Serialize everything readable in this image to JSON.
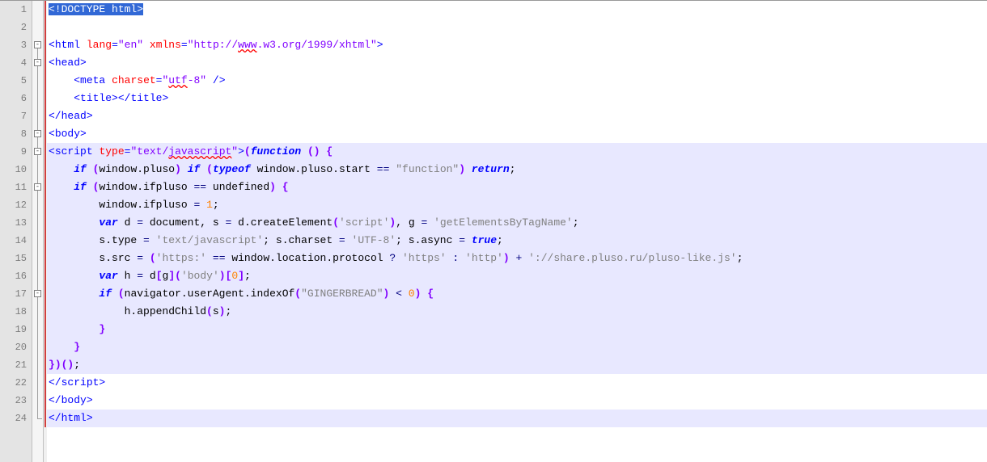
{
  "lineCount": 24,
  "selectedLine": 1,
  "highlightStart": 9,
  "highlightEnd": 21,
  "currentLine": 24,
  "foldIcons": [
    {
      "line": 3,
      "glyph": "-"
    },
    {
      "line": 4,
      "glyph": "-"
    },
    {
      "line": 8,
      "glyph": "-"
    },
    {
      "line": 9,
      "glyph": "-"
    },
    {
      "line": 11,
      "glyph": "-"
    },
    {
      "line": 17,
      "glyph": "-"
    }
  ],
  "foldVline": {
    "startLine": 3,
    "endLine": 24
  },
  "marginLine": {
    "startLine": 1,
    "endLine": 24
  },
  "code": {
    "l1_sel": "<!DOCTYPE html>",
    "l3": {
      "open": "<",
      "tag": "html",
      "sp": " ",
      "a1": "lang",
      "eq": "=",
      "v1": "\"en\"",
      "sp2": " ",
      "a2": "xmlns",
      "eq2": "=",
      "v2": "\"http://",
      "wavy": "www",
      "v2b": ".w3.org/1999/xhtml\"",
      "close": ">"
    },
    "l4": {
      "open": "<",
      "tag": "head",
      "close": ">"
    },
    "l5": {
      "ind": "    ",
      "open": "<",
      "tag": "meta",
      "sp": " ",
      "a": "charset",
      "eq": "=",
      "v1": "\"",
      "wavy": "utf",
      "v2": "-8\"",
      "sp2": " ",
      "close": "/>"
    },
    "l6": {
      "ind": "    ",
      "open": "<",
      "tag": "title",
      "close": "></",
      "tag2": "title",
      "close2": ">"
    },
    "l7": {
      "open": "</",
      "tag": "head",
      "close": ">"
    },
    "l8": {
      "open": "<",
      "tag": "body",
      "close": ">"
    },
    "l9": {
      "open": "<",
      "tag": "script",
      "sp": " ",
      "a": "type",
      "eq": "=",
      "v1": "\"text/",
      "wavy": "javascript",
      "v2": "\"",
      "close": ">",
      "p": "(",
      "kw": "function",
      "sp2": " ",
      "p2": "()",
      "sp3": " ",
      "b": "{"
    },
    "l10": {
      "ind": "    ",
      "kw": "if",
      "sp": " ",
      "p": "(",
      "txt": "window.pluso",
      "p2": ")",
      "sp2": " ",
      "kw2": "if",
      "sp3": " ",
      "p3": "(",
      "kw3": "typeof",
      "sp4": " ",
      "txt2": "window.pluso.start ",
      "op": "==",
      "sp5": " ",
      "str": "\"function\"",
      "p4": ")",
      "sp6": " ",
      "kw4": "return",
      "sc": ";"
    },
    "l11": {
      "ind": "    ",
      "kw": "if",
      "sp": " ",
      "p": "(",
      "txt": "window.ifpluso ",
      "op": "==",
      "sp2": " ",
      "txt2": "undefined",
      "p2": ")",
      "sp3": " ",
      "b": "{"
    },
    "l12": {
      "ind": "        ",
      "txt": "window.ifpluso ",
      "op": "=",
      "sp": " ",
      "num": "1",
      "sc": ";"
    },
    "l13": {
      "ind": "        ",
      "kw": "var",
      "sp": " ",
      "txt": "d ",
      "op": "=",
      "sp2": " ",
      "txt2": "document",
      "c": ",",
      "sp3": " ",
      "txt3": "s ",
      "op2": "=",
      "sp4": " ",
      "txt4": "d.createElement",
      "p": "(",
      "str": "'script'",
      "p2": ")",
      "c2": ",",
      "sp5": " ",
      "txt5": "g ",
      "op3": "=",
      "sp6": " ",
      "str2": "'getElementsByTagName'",
      "sc": ";"
    },
    "l14": {
      "ind": "        ",
      "txt": "s.type ",
      "op": "=",
      "sp": " ",
      "str": "'text/javascript'",
      "sc": ";",
      "sp2": " ",
      "txt2": "s.charset ",
      "op2": "=",
      "sp3": " ",
      "str2": "'UTF-8'",
      "sc2": ";",
      "sp4": " ",
      "txt3": "s.async ",
      "op3": "=",
      "sp5": " ",
      "kw": "true",
      "sc3": ";"
    },
    "l15": {
      "ind": "        ",
      "txt": "s.src ",
      "op": "=",
      "sp": " ",
      "p": "(",
      "str": "'https:'",
      "sp2": " ",
      "op2": "==",
      "sp3": " ",
      "txt2": "window.location.protocol ",
      "op3": "?",
      "sp4": " ",
      "str2": "'https'",
      "sp5": " ",
      "op4": ":",
      "sp6": " ",
      "str3": "'http'",
      "p2": ")",
      "sp7": " ",
      "op5": "+",
      "sp8": " ",
      "str4": "'://share.pluso.ru/pluso-like.js'",
      "sc": ";"
    },
    "l16": {
      "ind": "        ",
      "kw": "var",
      "sp": " ",
      "txt": "h ",
      "op": "=",
      "sp2": " ",
      "txt2": "d",
      "p": "[",
      "txt3": "g",
      "p2": "]",
      "p3": "(",
      "str": "'body'",
      "p4": ")",
      "p5": "[",
      "num": "0",
      "p6": "]",
      "sc": ";"
    },
    "l17": {
      "ind": "        ",
      "kw": "if",
      "sp": " ",
      "p": "(",
      "txt": "navigator.userAgent.indexOf",
      "p2": "(",
      "str": "\"GINGERBREAD\"",
      "p3": ")",
      "sp2": " ",
      "op": "<",
      "sp3": " ",
      "num": "0",
      "p4": ")",
      "sp4": " ",
      "b": "{"
    },
    "l18": {
      "ind": "            ",
      "txt": "h.appendChild",
      "p": "(",
      "txt2": "s",
      "p2": ")",
      "sc": ";"
    },
    "l19": {
      "ind": "        ",
      "b": "}"
    },
    "l20": {
      "ind": "    ",
      "b": "}"
    },
    "l21": {
      "b": "}",
      "p": ")()",
      "sc": ";"
    },
    "l22": {
      "open": "</",
      "tag": "script",
      "close": ">"
    },
    "l23": {
      "open": "</",
      "tag": "body",
      "close": ">"
    },
    "l24": {
      "open": "</",
      "tag": "html",
      "close": ">"
    }
  }
}
